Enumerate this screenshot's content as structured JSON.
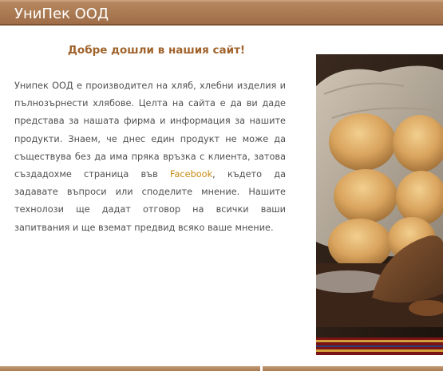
{
  "header": {
    "site_title": "УниПек ООД"
  },
  "main": {
    "welcome_heading": "Добре дошли в нашия сайт!",
    "intro_before_link": "Унипек ООД е производител на хляб, хлебни изделия и пълнозърнести хлябове. Целта на сайта е да ви даде представа за нашата фирма и информация за нашите продукти. Знаем, че днес един продукт не може да съществува без да има пряка връзка с клиента, затова създадохме страница във ",
    "facebook_link": "Facebook",
    "intro_after_link": ", където да задавате въпроси или споделите мнение. Нашите технолози ще дадат отговор на всички ваши запитвания и ще вземат предвид всяко ваше мнение."
  },
  "colors": {
    "header_brown": "#a57350",
    "heading_brown": "#a0632c",
    "link_gold": "#c78b13",
    "body_text": "#505050"
  }
}
